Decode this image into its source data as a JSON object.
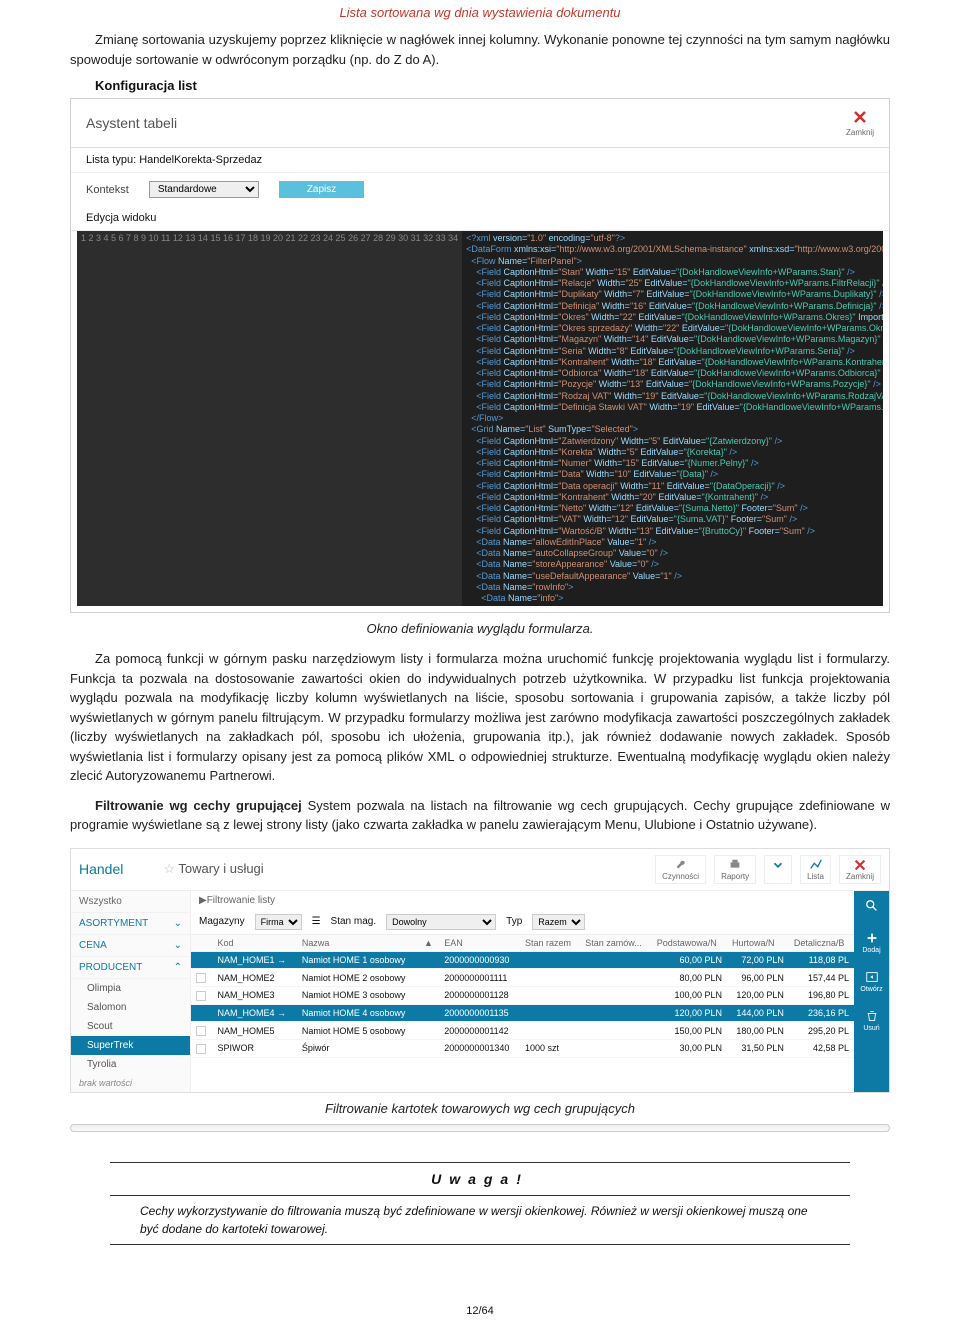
{
  "pageTitle": "Lista sortowana wg dnia wystawienia dokumentu",
  "paragraph1": "Zmianę sortowania uzyskujemy poprzez kliknięcie w nagłówek innej kolumny. Wykonanie ponowne tej czynności na tym samym nagłówku spowoduje sortowanie w odwróconym porządku (np. do Z do A).",
  "configHeading": "Konfiguracja list",
  "asystentPanel": {
    "title": "Asystent tabeli",
    "closeLabel": "Zamknij",
    "listType": "Lista typu: HandelKorekta-Sprzedaz",
    "kontekstLabel": "Kontekst",
    "kontekstValue": "Standardowe",
    "zapisz": "Zapisz",
    "editLabel": "Edycja widoku"
  },
  "codeLines": 34,
  "caption1": "Okno definiowania wyglądu formularza.",
  "paragraph2": "Za pomocą funkcji w górnym pasku narzędziowym listy i formularza można uruchomić funkcję projektowania wyglądu list i formularzy. Funkcja ta pozwala na dostosowanie zawartości okien do indywidualnych potrzeb użytkownika. W przypadku list funkcja projektowania wyglądu pozwala na modyfikację liczby kolumn wyświetlanych na liście, sposobu sortowania i grupowania zapisów, a także liczby pól wyświetlanych w górnym panelu filtrującym. W przypadku formularzy możliwa jest zarówno modyfikacja zawartości poszczególnych zakładek (liczby wyświetlanych na zakładkach pól, sposobu ich ułożenia, grupowania itp.), jak również dodawanie nowych zakładek. Sposób wyświetlania list i formularzy opisany jest za pomocą plików XML o odpowiedniej strukturze. Ewentualną modyfikację wyglądu okien należy zlecić Autoryzowanemu Partnerowi.",
  "paragraph3Bold": "Filtrowanie wg cechy grupującej",
  "paragraph3": " System pozwala na listach na filtrowanie wg cech grupujących. Cechy grupujące zdefiniowane w programie wyświetlane są z lewej strony listy (jako czwarta zakładka w panelu zawierającym Menu, Ulubione i Ostatnio używane).",
  "handel": {
    "title": "Handel",
    "subtitle": "Towary i usługi",
    "actions": [
      "Czynności",
      "Raporty",
      "",
      "Lista",
      "Zamknij"
    ],
    "sidebar": {
      "wszystko": "Wszystko",
      "asortyment": "ASORTYMENT",
      "cena": "CENA",
      "producent": "PRODUCENT",
      "subs": [
        "Olimpia",
        "Salomon",
        "Scout",
        "SuperTrek",
        "Tyrolia"
      ],
      "foot": "brak wartości"
    },
    "filterLabel": "▶Filtrowanie listy",
    "filters": {
      "magazyny": "Magazyny",
      "firma": "Firma",
      "stanmag": "Stan mag.",
      "dowolny": "Dowolny",
      "typ": "Typ",
      "razem": "Razem"
    },
    "columns": [
      "",
      "Kod",
      "Nazwa",
      "▲",
      "EAN",
      "Stan razem",
      "Stan zamów...",
      "Podstawowa/N",
      "Hurtowa/N",
      "Detaliczna/B"
    ],
    "rows": [
      {
        "sel": true,
        "kod": "NAM_HOME1",
        "nazwa": "Namiot HOME 1 osobowy",
        "ean": "2000000000930",
        "stan": "",
        "zam": "",
        "pod": "60,00 PLN",
        "hurt": "72,00 PLN",
        "det": "118,08 PL"
      },
      {
        "sel": false,
        "kod": "NAM_HOME2",
        "nazwa": "Namiot HOME 2 osobowy",
        "ean": "2000000001111",
        "stan": "",
        "zam": "",
        "pod": "80,00 PLN",
        "hurt": "96,00 PLN",
        "det": "157,44 PL"
      },
      {
        "sel": false,
        "kod": "NAM_HOME3",
        "nazwa": "Namiot HOME 3 osobowy",
        "ean": "2000000001128",
        "stan": "",
        "zam": "",
        "pod": "100,00 PLN",
        "hurt": "120,00 PLN",
        "det": "196,80 PL"
      },
      {
        "sel": true,
        "kod": "NAM_HOME4",
        "nazwa": "Namiot HOME 4 osobowy",
        "ean": "2000000001135",
        "stan": "",
        "zam": "",
        "pod": "120,00 PLN",
        "hurt": "144,00 PLN",
        "det": "236,16 PL"
      },
      {
        "sel": false,
        "kod": "NAM_HOME5",
        "nazwa": "Namiot HOME 5 osobowy",
        "ean": "2000000001142",
        "stan": "",
        "zam": "",
        "pod": "150,00 PLN",
        "hurt": "180,00 PLN",
        "det": "295,20 PL"
      },
      {
        "sel": false,
        "kod": "SPIWOR",
        "nazwa": "Śpiwór",
        "ean": "2000000001340",
        "stan": "1000 szt",
        "zam": "",
        "pod": "30,00 PLN",
        "hurt": "31,50 PLN",
        "det": "42,58 PL"
      }
    ],
    "iconButtons": [
      "",
      "Dodaj",
      "Otwórz",
      "Usuń"
    ]
  },
  "caption2": "Filtrowanie kartotek towarowych wg cech grupujących",
  "uwaga": {
    "title": "Uwaga!",
    "text": "Cechy wykorzystywanie do filtrowania muszą być zdefiniowane w wersji okienkowej. Również w wersji okienkowej muszą one być dodane do kartoteki towarowej."
  },
  "pageNumber": "12/64"
}
